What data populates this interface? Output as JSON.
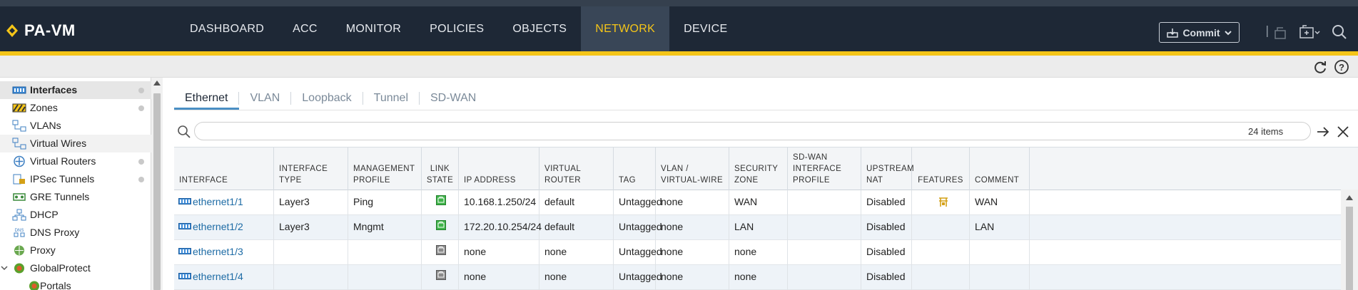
{
  "header": {
    "logo": "PA-VM",
    "nav_tabs": [
      "DASHBOARD",
      "ACC",
      "MONITOR",
      "POLICIES",
      "OBJECTS",
      "NETWORK",
      "DEVICE"
    ],
    "active_tab": "NETWORK",
    "commit_label": "Commit",
    "accent_color": "#f5c518",
    "bg_color": "#1e2836"
  },
  "subbar": {
    "icons": [
      "refresh-icon",
      "help-icon"
    ]
  },
  "sidebar": {
    "items": [
      {
        "label": "Interfaces",
        "icon": "interfaces-icon",
        "active": true,
        "dot": true
      },
      {
        "label": "Zones",
        "icon": "zones-icon",
        "dot": true
      },
      {
        "label": "VLANs",
        "icon": "vlans-icon",
        "dot": false
      },
      {
        "label": "Virtual Wires",
        "icon": "virtual-wires-icon",
        "dot": false,
        "hover": true
      },
      {
        "label": "Virtual Routers",
        "icon": "virtual-routers-icon",
        "dot": true
      },
      {
        "label": "IPSec Tunnels",
        "icon": "ipsec-tunnels-icon",
        "dot": true
      },
      {
        "label": "GRE Tunnels",
        "icon": "gre-tunnels-icon",
        "dot": false
      },
      {
        "label": "DHCP",
        "icon": "dhcp-icon",
        "dot": false
      },
      {
        "label": "DNS Proxy",
        "icon": "dns-proxy-icon",
        "dot": false
      },
      {
        "label": "Proxy",
        "icon": "proxy-icon",
        "dot": false
      },
      {
        "label": "GlobalProtect",
        "icon": "globalprotect-icon",
        "dot": false
      },
      {
        "label": "Portals",
        "icon": "portals-icon",
        "dot": false
      }
    ]
  },
  "subtabs": [
    "Ethernet",
    "VLAN",
    "Loopback",
    "Tunnel",
    "SD-WAN"
  ],
  "active_subtab": "Ethernet",
  "filter": {
    "count_text": "24 items"
  },
  "table": {
    "columns": [
      "INTERFACE",
      "INTERFACE TYPE",
      "MANAGEMENT PROFILE",
      "LINK STATE",
      "IP ADDRESS",
      "VIRTUAL ROUTER",
      "TAG",
      "VLAN / VIRTUAL-WIRE",
      "SECURITY ZONE",
      "SD-WAN INTERFACE PROFILE",
      "UPSTREAM NAT",
      "FEATURES",
      "COMMENT"
    ],
    "rows": [
      {
        "interface": "ethernet1/1",
        "type": "Layer3",
        "mgmt": "Ping",
        "link": "up",
        "ip": "10.168.1.250/24",
        "vr": "default",
        "tag": "Untagged",
        "vlan": "none",
        "zone": "WAN",
        "sdwan": "",
        "nat": "Disabled",
        "feature": "feature-icon",
        "comment": "WAN"
      },
      {
        "interface": "ethernet1/2",
        "type": "Layer3",
        "mgmt": "Mngmt",
        "link": "up",
        "ip": "172.20.10.254/24",
        "vr": "default",
        "tag": "Untagged",
        "vlan": "none",
        "zone": "LAN",
        "sdwan": "",
        "nat": "Disabled",
        "feature": "",
        "comment": "LAN"
      },
      {
        "interface": "ethernet1/3",
        "type": "",
        "mgmt": "",
        "link": "unknown",
        "ip": "none",
        "vr": "none",
        "tag": "Untagged",
        "vlan": "none",
        "zone": "none",
        "sdwan": "",
        "nat": "Disabled",
        "feature": "",
        "comment": ""
      },
      {
        "interface": "ethernet1/4",
        "type": "",
        "mgmt": "",
        "link": "unknown",
        "ip": "none",
        "vr": "none",
        "tag": "Untagged",
        "vlan": "none",
        "zone": "none",
        "sdwan": "",
        "nat": "Disabled",
        "feature": "",
        "comment": ""
      }
    ]
  }
}
